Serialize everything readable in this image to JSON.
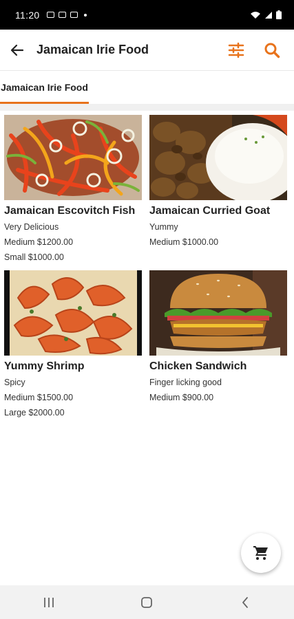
{
  "status_bar": {
    "time": "11:20"
  },
  "app_bar": {
    "title": "Jamaican Irie Food",
    "back_icon": "arrow-back-icon",
    "filter_icon": "sliders-icon",
    "search_icon": "search-icon",
    "accent_color": "#e8731c"
  },
  "tabs": [
    {
      "label": "Jamaican Irie Food",
      "selected": true
    }
  ],
  "items": [
    {
      "name": "Jamaican Escovitch Fish",
      "description": "Very Delicious",
      "prices": [
        "Medium $1200.00",
        "Small $1000.00"
      ]
    },
    {
      "name": "Jamaican Curried Goat",
      "description": "Yummy",
      "prices": [
        "Medium $1000.00"
      ]
    },
    {
      "name": "Yummy Shrimp",
      "description": "Spicy",
      "prices": [
        "Medium $1500.00",
        "Large $2000.00"
      ]
    },
    {
      "name": "Chicken Sandwich",
      "description": "Finger licking good",
      "prices": [
        "Medium $900.00"
      ]
    }
  ],
  "fab": {
    "icon": "cart-icon"
  },
  "nav_bar": {
    "recents_icon": "recents-icon",
    "home_icon": "home-icon",
    "back_icon": "back-chevron-icon"
  }
}
